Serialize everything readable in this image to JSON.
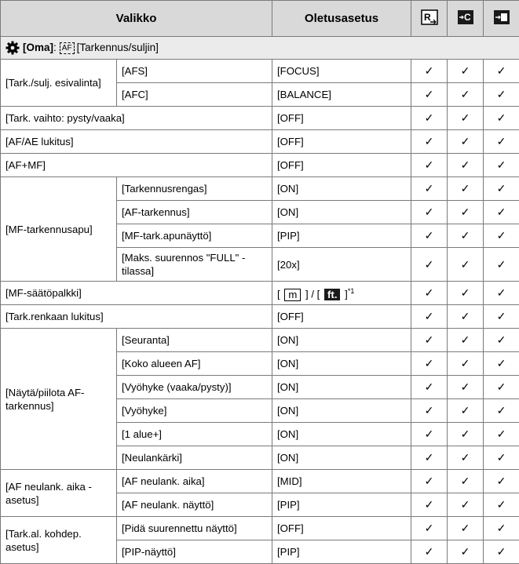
{
  "header": {
    "menu": "Valikko",
    "default": "Oletusasetus",
    "icon1": "R",
    "icon2": "C",
    "icon3": "↩"
  },
  "section": {
    "oma": "[Oma]",
    "sep": ":",
    "af": "AF",
    "title": "[Tarkennus/suljin]"
  },
  "check": "✓",
  "rows": {
    "r1": {
      "a": "[Tark./sulj. esivalinta]",
      "b": "[AFS]",
      "v": "[FOCUS]"
    },
    "r2": {
      "b": "[AFC]",
      "v": "[BALANCE]"
    },
    "r3": {
      "a": "[Tark. vaihto: pysty/vaaka]",
      "v": "[OFF]"
    },
    "r4": {
      "a": "[AF/AE lukitus]",
      "v": "[OFF]"
    },
    "r5": {
      "a": "[AF+MF]",
      "v": "[OFF]"
    },
    "r6": {
      "a": "[MF-tarkennusapu]",
      "b": "[Tarkennusrengas]",
      "v": "[ON]"
    },
    "r7": {
      "b": "[AF-tarkennus]",
      "v": "[ON]"
    },
    "r8": {
      "b": "[MF-tark.apunäyttö]",
      "v": "[PIP]"
    },
    "r9": {
      "b": "[Maks. suurennos \"FULL\" -tilassa]",
      "v": "[20x]"
    },
    "r10": {
      "a": "[MF-säätöpalkki]",
      "v_open": "[",
      "m": "m",
      "v_mid": "] / [",
      "ft": "ft.",
      "v_close": "]",
      "sup": "*1"
    },
    "r11": {
      "a": "[Tark.renkaan lukitus]",
      "v": "[OFF]"
    },
    "r12": {
      "a": "[Näytä/piilota AF-tarkennus]",
      "b": "[Seuranta]",
      "v": "[ON]"
    },
    "r13": {
      "b": "[Koko alueen AF]",
      "v": "[ON]"
    },
    "r14": {
      "b": "[Vyöhyke (vaaka/pysty)]",
      "v": "[ON]"
    },
    "r15": {
      "b": "[Vyöhyke]",
      "v": "[ON]"
    },
    "r16": {
      "b": "[1 alue+]",
      "v": "[ON]"
    },
    "r17": {
      "b": "[Neulankärki]",
      "v": "[ON]"
    },
    "r18": {
      "a": "[AF neulank. aika -asetus]",
      "b": "[AF neulank. aika]",
      "v": "[MID]"
    },
    "r19": {
      "b": "[AF neulank. näyttö]",
      "v": "[PIP]"
    },
    "r20": {
      "a": "[Tark.al. kohdep. asetus]",
      "b": "[Pidä suurennettu näyttö]",
      "v": "[OFF]"
    },
    "r21": {
      "b": "[PIP-näyttö]",
      "v": "[PIP]"
    }
  }
}
